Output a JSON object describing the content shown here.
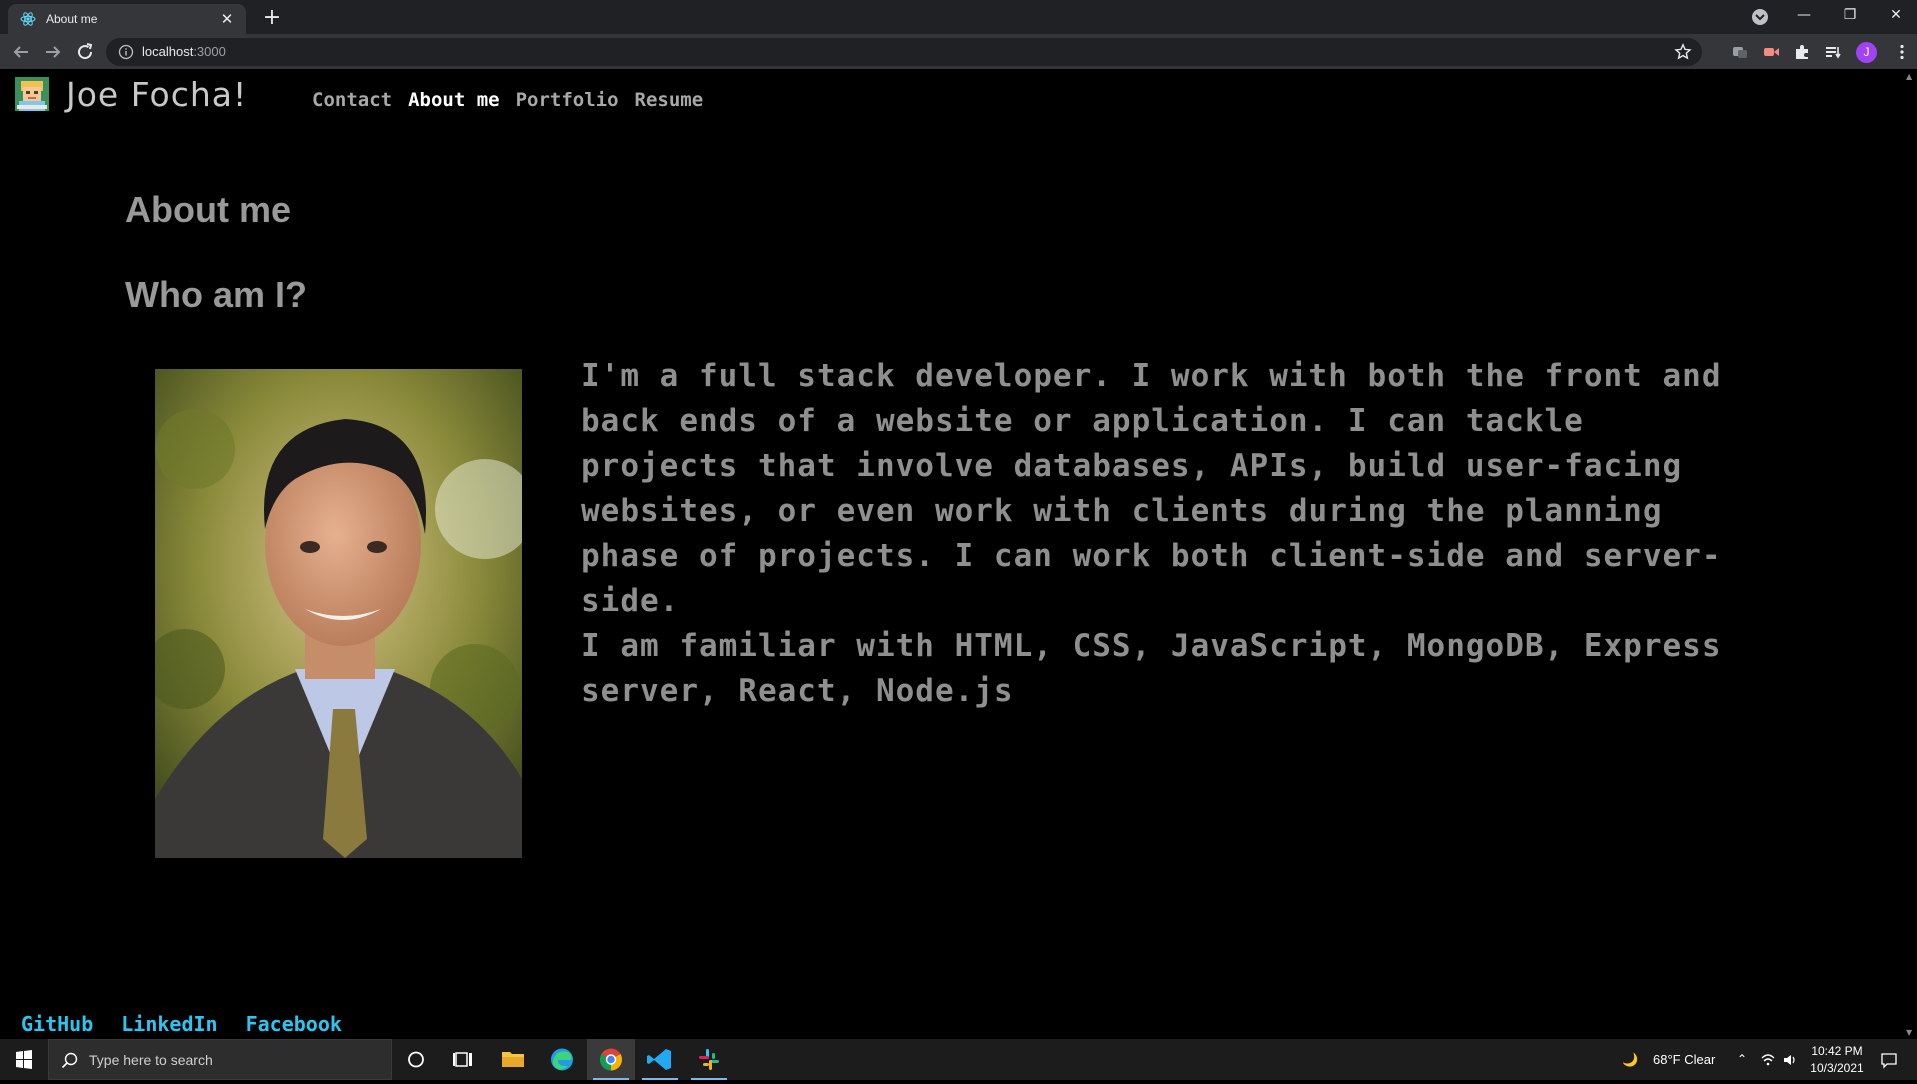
{
  "browser": {
    "tab_title": "About me",
    "url_host": "localhost",
    "url_port": ":3000"
  },
  "site": {
    "title": "Joe Focha!",
    "nav": [
      {
        "label": "Contact",
        "active": false
      },
      {
        "label": "About me",
        "active": true
      },
      {
        "label": "Portfolio",
        "active": false
      },
      {
        "label": "Resume",
        "active": false
      }
    ],
    "heading": "About me",
    "subheading": "Who am I?",
    "bio_p1": "I'm a full stack developer. I work with both the front and back ends of a website or application. I can tackle projects that involve databases, APIs, build user-facing websites, or even work with clients during the planning phase of projects. I can work both client-side and server-side.",
    "bio_p2": "I am familiar with HTML, CSS, JavaScript, MongoDB, Express server, React, Node.js",
    "footer_links": [
      "GitHub",
      "LinkedIn",
      "Facebook"
    ]
  },
  "taskbar": {
    "search_placeholder": "Type here to search",
    "weather": "68°F  Clear",
    "time": "10:42 PM",
    "date": "10/3/2021"
  },
  "colors": {
    "accent_link": "#2ec4f0",
    "avatar": "#a142f4"
  }
}
